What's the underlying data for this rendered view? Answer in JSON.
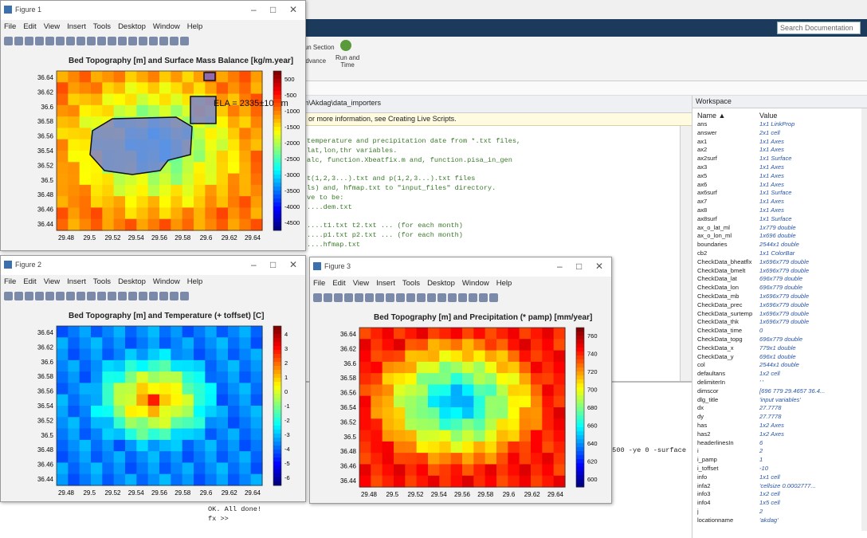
{
  "matlab": {
    "search_placeholder": "Search Documentation",
    "ribbon": {
      "run_section": "Run Section",
      "advance": "Advance",
      "run_and_time": "Run and\nTime"
    },
    "path": "em\\Akdag\\data_importers",
    "editor_banner": "or more information, see Creating Live Scripts.",
    "editor_banner_link": "Creating Live Scripts",
    "code_lines": [
      "temperature and precipitation date from *.txt files,",
      "lat,lon,thr variables.",
      "alc, function.Xbeatfix.m and, function.pisa_in_gen",
      "",
      "t(1,2,3...).txt and p(1,2,3...).txt files",
      "ls) and, hfmap.txt to \"input_files\" directory.",
      "ve to be:",
      "....dem.txt",
      "",
      "....t1.txt t2.txt ... (for each month)",
      "....p1.txt p2.txt ... (for each month)",
      "....hfmap.txt"
    ],
    "cmd_lines": [
      "-500 -ye 0 -surface",
      "OK. All done!",
      "fx >>"
    ]
  },
  "workspace": {
    "title": "Workspace",
    "col_name": "Name ▲",
    "col_value": "Value",
    "rows": [
      [
        "ans",
        "1x1 LinkProp"
      ],
      [
        "answer",
        "2x1 cell"
      ],
      [
        "ax1",
        "1x1 Axes"
      ],
      [
        "ax2",
        "1x1 Axes"
      ],
      [
        "ax2surf",
        "1x1 Surface"
      ],
      [
        "ax3",
        "1x1 Axes"
      ],
      [
        "ax5",
        "1x1 Axes"
      ],
      [
        "ax6",
        "1x1 Axes"
      ],
      [
        "ax6surf",
        "1x1 Surface"
      ],
      [
        "ax7",
        "1x1 Axes"
      ],
      [
        "ax8",
        "1x1 Axes"
      ],
      [
        "ax8surf",
        "1x1 Surface"
      ],
      [
        "ax_o_lat_ml",
        "1x779 double"
      ],
      [
        "ax_o_lon_ml",
        "1x696 double"
      ],
      [
        "boundaries",
        "2544x1 double"
      ],
      [
        "cb2",
        "1x1 ColorBar"
      ],
      [
        "CheckData_bheatflx",
        "1x696x779 double"
      ],
      [
        "CheckData_bmelt",
        "1x696x779 double"
      ],
      [
        "CheckData_lat",
        "696x779 double"
      ],
      [
        "CheckData_lon",
        "696x779 double"
      ],
      [
        "CheckData_mb",
        "1x696x779 double"
      ],
      [
        "CheckData_prec",
        "1x696x779 double"
      ],
      [
        "CheckData_surtemp",
        "1x696x779 double"
      ],
      [
        "CheckData_thk",
        "1x696x779 double"
      ],
      [
        "CheckData_time",
        "0"
      ],
      [
        "CheckData_topg",
        "696x779 double"
      ],
      [
        "CheckData_x",
        "779x1 double"
      ],
      [
        "CheckData_y",
        "696x1 double"
      ],
      [
        "col",
        "2544x1 double"
      ],
      [
        "defaultans",
        "1x2 cell"
      ],
      [
        "delimiterIn",
        "' '"
      ],
      [
        "dimscor",
        "[696 779 29.4657 36.4..."
      ],
      [
        "dlg_title",
        "'input variables'"
      ],
      [
        "dx",
        "27.7778"
      ],
      [
        "dy",
        "27.7778"
      ],
      [
        "has",
        "1x2 Axes"
      ],
      [
        "has2",
        "1x2 Axes"
      ],
      [
        "headerlinesIn",
        "6"
      ],
      [
        "i",
        "2"
      ],
      [
        "i_pamp",
        "1"
      ],
      [
        "i_toffset",
        "-10"
      ],
      [
        "info",
        "1x1 cell"
      ],
      [
        "infa2",
        "'cellsize      0.0002777..."
      ],
      [
        "info3",
        "1x2 cell"
      ],
      [
        "info4",
        "1x5 cell"
      ],
      [
        "j",
        "2"
      ],
      [
        "locationname",
        "'akdag'"
      ]
    ]
  },
  "fig1": {
    "title": "Figure 1",
    "plot_title": "Bed Topography [m] and Surface Mass Balance [kg/m.year]",
    "annotation": "ELA = 2335±100 m",
    "cbar_ticks": [
      "500",
      "-500",
      "-1000",
      "-1500",
      "-2000",
      "-2500",
      "-3000",
      "-3500",
      "-4000",
      "-4500"
    ]
  },
  "fig2": {
    "title": "Figure 2",
    "plot_title": "Bed Topography [m] and Temperature (+ toffset) [C]",
    "cbar_ticks": [
      "4",
      "3",
      "2",
      "1",
      "0",
      "-1",
      "-2",
      "-3",
      "-4",
      "-5",
      "-6"
    ]
  },
  "fig3": {
    "title": "Figure 3",
    "plot_title": "Bed Topography [m] and Precipitation (* pamp) [mm/year]",
    "cbar_ticks": [
      "760",
      "740",
      "720",
      "700",
      "680",
      "660",
      "640",
      "620",
      "600"
    ]
  },
  "menu": [
    "File",
    "Edit",
    "View",
    "Insert",
    "Tools",
    "Desktop",
    "Window",
    "Help"
  ],
  "yticks": [
    "36.64",
    "36.62",
    "36.6",
    "36.58",
    "36.56",
    "36.54",
    "36.52",
    "36.5",
    "36.48",
    "36.46",
    "36.44"
  ],
  "xticks": [
    "29.48",
    "29.5",
    "29.52",
    "29.54",
    "29.56",
    "29.58",
    "29.6",
    "29.62",
    "29.64"
  ]
}
